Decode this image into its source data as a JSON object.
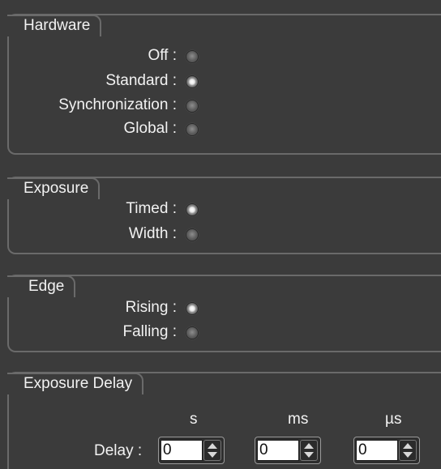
{
  "hardware": {
    "title": "Hardware",
    "options": [
      {
        "label": "Off :",
        "selected": false
      },
      {
        "label": "Standard :",
        "selected": true
      },
      {
        "label": "Synchronization :",
        "selected": false
      },
      {
        "label": "Global :",
        "selected": false
      }
    ]
  },
  "exposure": {
    "title": "Exposure",
    "options": [
      {
        "label": "Timed :",
        "selected": true
      },
      {
        "label": "Width :",
        "selected": false
      }
    ]
  },
  "edge": {
    "title": "Edge",
    "options": [
      {
        "label": "Rising :",
        "selected": true
      },
      {
        "label": "Falling :",
        "selected": false
      }
    ]
  },
  "exposure_delay": {
    "title": "Exposure Delay",
    "units": [
      "s",
      "ms",
      "µs"
    ],
    "delay_label": "Delay :",
    "values": [
      "0",
      "0",
      "0"
    ]
  },
  "colors": {
    "background": "#3b3b3b",
    "border": "#6a6a6a",
    "text": "#f2f2f2"
  }
}
